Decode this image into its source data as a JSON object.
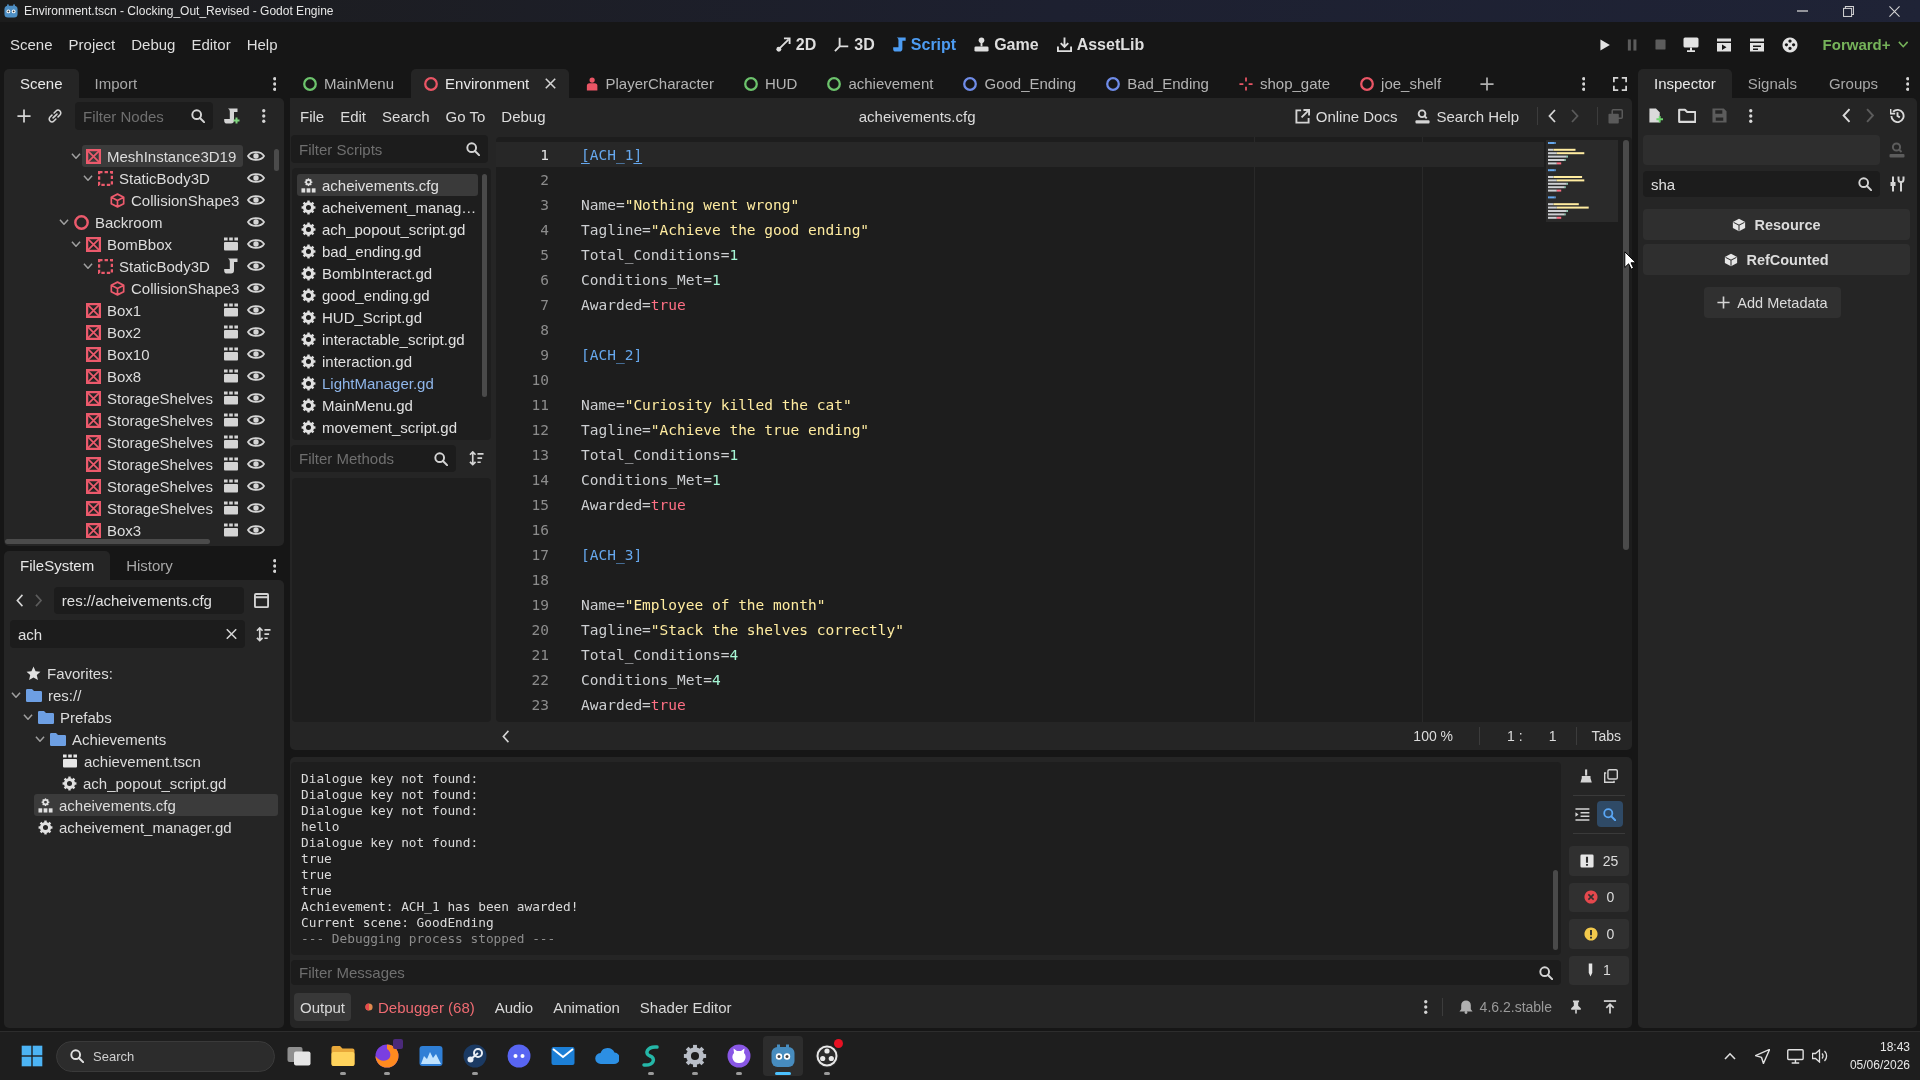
{
  "window": {
    "title": "Environment.tscn - Clocking_Out_Revised - Godot Engine"
  },
  "main_menu": [
    "Scene",
    "Project",
    "Debug",
    "Editor",
    "Help"
  ],
  "workspaces": [
    {
      "label": "2D",
      "kind": "canvas",
      "selected": false
    },
    {
      "label": "3D",
      "kind": "spatial",
      "selected": false
    },
    {
      "label": "Script",
      "kind": "script",
      "selected": true
    },
    {
      "label": "Game",
      "kind": "game",
      "selected": false
    },
    {
      "label": "AssetLib",
      "kind": "assetlib",
      "selected": false
    }
  ],
  "run_bar": {
    "buttons": [
      {
        "kind": "play",
        "disabled": false
      },
      {
        "kind": "pause",
        "disabled": true
      },
      {
        "kind": "stop",
        "disabled": true
      },
      {
        "kind": "remote",
        "disabled": false
      },
      {
        "kind": "runcurrent",
        "disabled": false
      },
      {
        "kind": "runcustom",
        "disabled": false
      },
      {
        "kind": "movie",
        "disabled": false
      }
    ],
    "renderer": "Forward+"
  },
  "scene_dock": {
    "tabs": [
      {
        "label": "Scene",
        "selected": true
      },
      {
        "label": "Import",
        "selected": false
      }
    ],
    "filter_placeholder": "Filter Nodes",
    "tree": [
      {
        "children": [
          {
            "label": "MeshInstance3D19",
            "kind": "mesh",
            "selected": true,
            "visible": true,
            "instanced": false,
            "script": false,
            "expanded": true,
            "children": [
              {
                "label": "StaticBody3D",
                "kind": "body",
                "selected": false,
                "visible": true,
                "instanced": false,
                "script": false,
                "expanded": true,
                "children": [
                  {
                    "label": "CollisionShape3",
                    "kind": "shape",
                    "selected": false,
                    "visible": true,
                    "instanced": false,
                    "script": false
                  }
                ]
              }
            ]
          }
        ]
      },
      {
        "label": "Backroom",
        "kind": "node",
        "selected": false,
        "visible": true,
        "instanced": false,
        "script": false,
        "expanded": true,
        "children": [
          {
            "label": "BomBbox",
            "kind": "mesh",
            "selected": false,
            "visible": true,
            "instanced": true,
            "script": false,
            "expanded": true,
            "children": [
              {
                "label": "StaticBody3D",
                "kind": "body",
                "selected": false,
                "visible": true,
                "instanced": false,
                "script": true,
                "expanded": true,
                "children": [
                  {
                    "label": "CollisionShape3",
                    "kind": "shape",
                    "selected": false,
                    "visible": true,
                    "instanced": false,
                    "script": false
                  }
                ]
              }
            ]
          },
          {
            "label": "Box1",
            "kind": "mesh",
            "selected": false,
            "visible": true,
            "instanced": true,
            "script": false
          },
          {
            "label": "Box2",
            "kind": "mesh",
            "selected": false,
            "visible": true,
            "instanced": true,
            "script": false
          },
          {
            "label": "Box10",
            "kind": "mesh",
            "selected": false,
            "visible": true,
            "instanced": true,
            "script": false
          },
          {
            "label": "Box8",
            "kind": "mesh",
            "selected": false,
            "visible": true,
            "instanced": true,
            "script": false
          },
          {
            "label": "StorageShelves",
            "kind": "mesh",
            "selected": false,
            "visible": true,
            "instanced": true,
            "script": false
          },
          {
            "label": "StorageShelves",
            "kind": "mesh",
            "selected": false,
            "visible": true,
            "instanced": true,
            "script": false
          },
          {
            "label": "StorageShelves",
            "kind": "mesh",
            "selected": false,
            "visible": true,
            "instanced": true,
            "script": false
          },
          {
            "label": "StorageShelves",
            "kind": "mesh",
            "selected": false,
            "visible": true,
            "instanced": true,
            "script": false
          },
          {
            "label": "StorageShelves",
            "kind": "mesh",
            "selected": false,
            "visible": true,
            "instanced": true,
            "script": false
          },
          {
            "label": "StorageShelves",
            "kind": "mesh",
            "selected": false,
            "visible": true,
            "instanced": true,
            "script": false
          },
          {
            "label": "Box3",
            "kind": "mesh",
            "selected": false,
            "visible": true,
            "instanced": true,
            "script": false
          }
        ]
      }
    ]
  },
  "filesystem_dock": {
    "tabs": [
      {
        "label": "FileSystem",
        "selected": true
      },
      {
        "label": "History",
        "selected": false
      }
    ],
    "nav": [
      {
        "kind": "back",
        "disabled": false
      },
      {
        "kind": "forward",
        "disabled": true
      }
    ],
    "path": "res://acheivements.cfg",
    "search": "ach",
    "tree": [
      {
        "label": "Favorites:",
        "kind": "favorites",
        "selected": false
      },
      {
        "label": "res://",
        "kind": "folder",
        "selected": false,
        "expanded": true,
        "children": [
          {
            "label": "Prefabs",
            "kind": "folder",
            "selected": false,
            "expanded": true,
            "children": [
              {
                "label": "Achievements",
                "kind": "folder",
                "selected": false,
                "expanded": true,
                "children": [
                  {
                    "label": "achievement.tscn",
                    "kind": "scene",
                    "selected": false
                  },
                  {
                    "label": "ach_popout_script.gd",
                    "kind": "script",
                    "selected": false
                  }
                ]
              }
            ]
          },
          {
            "label": "acheivements.cfg",
            "kind": "text",
            "selected": true
          },
          {
            "label": "acheivement_manager.gd",
            "kind": "script",
            "selected": false
          }
        ]
      }
    ]
  },
  "scene_tabs": [
    {
      "label": "MainMenu",
      "kind": "control",
      "selected": false
    },
    {
      "label": "Environment",
      "kind": "spatial",
      "selected": true
    },
    {
      "label": "PlayerCharacter",
      "kind": "character",
      "selected": false
    },
    {
      "label": "HUD",
      "kind": "control",
      "selected": false
    },
    {
      "label": "achievement",
      "kind": "control",
      "selected": false
    },
    {
      "label": "Good_Ending",
      "kind": "node2d",
      "selected": false
    },
    {
      "label": "Bad_Ending",
      "kind": "node2d",
      "selected": false
    },
    {
      "label": "shop_gate",
      "kind": "marker",
      "selected": false
    },
    {
      "label": "joe_shelf",
      "kind": "spatial",
      "selected": false
    }
  ],
  "script_editor": {
    "menu": [
      "File",
      "Edit",
      "Search",
      "Go To",
      "Debug"
    ],
    "title": "acheivements.cfg",
    "links": [
      {
        "label": "Online Docs",
        "kind": "docs"
      },
      {
        "label": "Search Help",
        "kind": "help"
      }
    ],
    "nav": [
      {
        "kind": "back",
        "disabled": false
      },
      {
        "kind": "forward",
        "disabled": true
      },
      {
        "kind": "panels",
        "disabled": true
      }
    ],
    "scripts_filter_placeholder": "Filter Scripts",
    "scripts": [
      {
        "label": "acheivements.cfg",
        "kind": "text",
        "selected": true,
        "color": "#e0e0e0"
      },
      {
        "label": "acheivement_manag…",
        "kind": "script",
        "selected": false,
        "color": "#e0e0e0"
      },
      {
        "label": "ach_popout_script.gd",
        "kind": "script",
        "selected": false,
        "color": "#e0e0e0"
      },
      {
        "label": "bad_ending.gd",
        "kind": "script",
        "selected": false,
        "color": "#e0e0e0"
      },
      {
        "label": "BombInteract.gd",
        "kind": "script",
        "selected": false,
        "color": "#e0e0e0"
      },
      {
        "label": "good_ending.gd",
        "kind": "script",
        "selected": false,
        "color": "#e0e0e0"
      },
      {
        "label": "HUD_Script.gd",
        "kind": "script",
        "selected": false,
        "color": "#e0e0e0"
      },
      {
        "label": "interactable_script.gd",
        "kind": "script",
        "selected": false,
        "color": "#e0e0e0"
      },
      {
        "label": "interaction.gd",
        "kind": "script",
        "selected": false,
        "color": "#e0e0e0"
      },
      {
        "label": "LightManager.gd",
        "kind": "script",
        "selected": false,
        "color": "#8fb6ea"
      },
      {
        "label": "MainMenu.gd",
        "kind": "script",
        "selected": false,
        "color": "#e0e0e0"
      },
      {
        "label": "movement_script.gd",
        "kind": "script",
        "selected": false,
        "color": "#e0e0e0"
      }
    ],
    "methods_filter_placeholder": "Filter Methods",
    "lines": [
      {
        "number": "1",
        "current": true,
        "tokens": [
          {
            "kind": "bracket",
            "text": "[",
            "matched": true
          },
          {
            "kind": "section",
            "text": "ACH_1"
          },
          {
            "kind": "bracket",
            "text": "]",
            "matched": true
          }
        ]
      },
      {
        "number": "2",
        "current": false
      },
      {
        "number": "3",
        "current": false,
        "tokens": [
          {
            "kind": "key",
            "text": "Name="
          },
          {
            "kind": "string",
            "text": "\"Nothing went wrong\""
          }
        ]
      },
      {
        "number": "4",
        "current": false,
        "tokens": [
          {
            "kind": "key",
            "text": "Tagline="
          },
          {
            "kind": "string",
            "text": "\"Achieve the good ending\""
          }
        ]
      },
      {
        "number": "5",
        "current": false,
        "tokens": [
          {
            "kind": "key",
            "text": "Total_Conditions="
          },
          {
            "kind": "number",
            "text": "1"
          }
        ]
      },
      {
        "number": "6",
        "current": false,
        "tokens": [
          {
            "kind": "key",
            "text": "Conditions_Met="
          },
          {
            "kind": "number",
            "text": "1"
          }
        ]
      },
      {
        "number": "7",
        "current": false,
        "tokens": [
          {
            "kind": "key",
            "text": "Awarded="
          },
          {
            "kind": "keyword",
            "text": "true"
          }
        ]
      },
      {
        "number": "8",
        "current": false
      },
      {
        "number": "9",
        "current": false,
        "tokens": [
          {
            "kind": "bracket",
            "text": "[",
            "matched": false
          },
          {
            "kind": "section",
            "text": "ACH_2"
          },
          {
            "kind": "bracket",
            "text": "]",
            "matched": false
          }
        ]
      },
      {
        "number": "10",
        "current": false
      },
      {
        "number": "11",
        "current": false,
        "tokens": [
          {
            "kind": "key",
            "text": "Name="
          },
          {
            "kind": "string",
            "text": "\"Curiosity killed the cat\""
          }
        ]
      },
      {
        "number": "12",
        "current": false,
        "tokens": [
          {
            "kind": "key",
            "text": "Tagline="
          },
          {
            "kind": "string",
            "text": "\"Achieve the true ending\""
          }
        ]
      },
      {
        "number": "13",
        "current": false,
        "tokens": [
          {
            "kind": "key",
            "text": "Total_Conditions="
          },
          {
            "kind": "number",
            "text": "1"
          }
        ]
      },
      {
        "number": "14",
        "current": false,
        "tokens": [
          {
            "kind": "key",
            "text": "Conditions_Met="
          },
          {
            "kind": "number",
            "text": "1"
          }
        ]
      },
      {
        "number": "15",
        "current": false,
        "tokens": [
          {
            "kind": "key",
            "text": "Awarded="
          },
          {
            "kind": "keyword",
            "text": "true"
          }
        ]
      },
      {
        "number": "16",
        "current": false
      },
      {
        "number": "17",
        "current": false,
        "tokens": [
          {
            "kind": "bracket",
            "text": "[",
            "matched": false
          },
          {
            "kind": "section",
            "text": "ACH_3"
          },
          {
            "kind": "bracket",
            "text": "]",
            "matched": false
          }
        ]
      },
      {
        "number": "18",
        "current": false
      },
      {
        "number": "19",
        "current": false,
        "tokens": [
          {
            "kind": "key",
            "text": "Name="
          },
          {
            "kind": "string",
            "text": "\"Employee of the month\""
          }
        ]
      },
      {
        "number": "20",
        "current": false,
        "tokens": [
          {
            "kind": "key",
            "text": "Tagline="
          },
          {
            "kind": "string",
            "text": "\"Stack the shelves correctly\""
          }
        ]
      },
      {
        "number": "21",
        "current": false,
        "tokens": [
          {
            "kind": "key",
            "text": "Total_Conditions="
          },
          {
            "kind": "number",
            "text": "4"
          }
        ]
      },
      {
        "number": "22",
        "current": false,
        "tokens": [
          {
            "kind": "key",
            "text": "Conditions_Met="
          },
          {
            "kind": "number",
            "text": "4"
          }
        ]
      },
      {
        "number": "23",
        "current": false,
        "tokens": [
          {
            "kind": "key",
            "text": "Awarded="
          },
          {
            "kind": "keyword",
            "text": "true"
          }
        ]
      }
    ],
    "status": {
      "zoom": "100 %",
      "line": "1 :",
      "column": "1",
      "indent": "Tabs"
    }
  },
  "output": {
    "lines": [
      {
        "text": "Dialogue key not found:",
        "kind": "log"
      },
      {
        "text": "Dialogue key not found:",
        "kind": "log"
      },
      {
        "text": "Dialogue key not found:",
        "kind": "log"
      },
      {
        "text": "hello",
        "kind": "log"
      },
      {
        "text": "Dialogue key not found:",
        "kind": "log"
      },
      {
        "text": "true",
        "kind": "log"
      },
      {
        "text": "true",
        "kind": "log"
      },
      {
        "text": "true",
        "kind": "log"
      },
      {
        "text": "Achievement: ACH_1 has been awarded!",
        "kind": "log"
      },
      {
        "text": "Current scene: GoodEnding",
        "kind": "log"
      },
      {
        "text": "--- Debugging process stopped ---",
        "kind": "status"
      }
    ],
    "filter_placeholder": "Filter Messages",
    "search_active": true,
    "counters": [
      {
        "kind": "messages",
        "count": "25"
      },
      {
        "kind": "errors",
        "count": "0"
      },
      {
        "kind": "warnings",
        "count": "0"
      },
      {
        "kind": "editor",
        "count": "1"
      }
    ],
    "tabs": [
      {
        "label": "Output",
        "kind": "plain",
        "selected": true
      },
      {
        "label": "Debugger (68)",
        "kind": "alert",
        "selected": false
      },
      {
        "label": "Audio",
        "kind": "plain",
        "selected": false
      },
      {
        "label": "Animation",
        "kind": "plain",
        "selected": false
      },
      {
        "label": "Shader Editor",
        "kind": "plain",
        "selected": false
      }
    ],
    "version": "4.6.2.stable"
  },
  "inspector": {
    "tabs": [
      {
        "label": "Inspector",
        "selected": true
      },
      {
        "label": "Signals",
        "selected": false
      },
      {
        "label": "Groups",
        "selected": false
      }
    ],
    "toolbar": [
      {
        "kind": "new",
        "disabled": false
      },
      {
        "kind": "open",
        "disabled": false
      },
      {
        "kind": "save",
        "disabled": true
      },
      {
        "kind": "menu",
        "disabled": false
      },
      {
        "kind": "back",
        "disabled": false
      },
      {
        "kind": "forward",
        "disabled": true
      },
      {
        "kind": "history",
        "disabled": false
      }
    ],
    "search": "sha",
    "sections": [
      "Resource",
      "RefCounted"
    ],
    "add_metadata": "Add Metadata"
  },
  "taskbar": {
    "search_placeholder": "Search",
    "apps": [
      {
        "kind": "taskview",
        "running": false,
        "active": false,
        "badge": false
      },
      {
        "kind": "files",
        "running": true,
        "active": false,
        "badge": false
      },
      {
        "kind": "browser",
        "running": true,
        "active": false,
        "badge": true
      },
      {
        "kind": "photos",
        "running": false,
        "active": false,
        "badge": false
      },
      {
        "kind": "steam",
        "running": true,
        "active": false,
        "badge": false
      },
      {
        "kind": "chat",
        "running": false,
        "active": false,
        "badge": false
      },
      {
        "kind": "mail",
        "running": false,
        "active": false,
        "badge": false
      },
      {
        "kind": "cloud",
        "running": false,
        "active": false,
        "badge": false
      },
      {
        "kind": "writer",
        "running": true,
        "active": false,
        "badge": false
      },
      {
        "kind": "settings",
        "running": true,
        "active": false,
        "badge": false
      },
      {
        "kind": "git",
        "running": true,
        "active": false,
        "badge": false
      },
      {
        "kind": "engine",
        "running": true,
        "active": true,
        "badge": false
      },
      {
        "kind": "recorder",
        "running": true,
        "active": false,
        "badge": true
      }
    ],
    "time": "18:43",
    "date": "05/06/2026"
  }
}
